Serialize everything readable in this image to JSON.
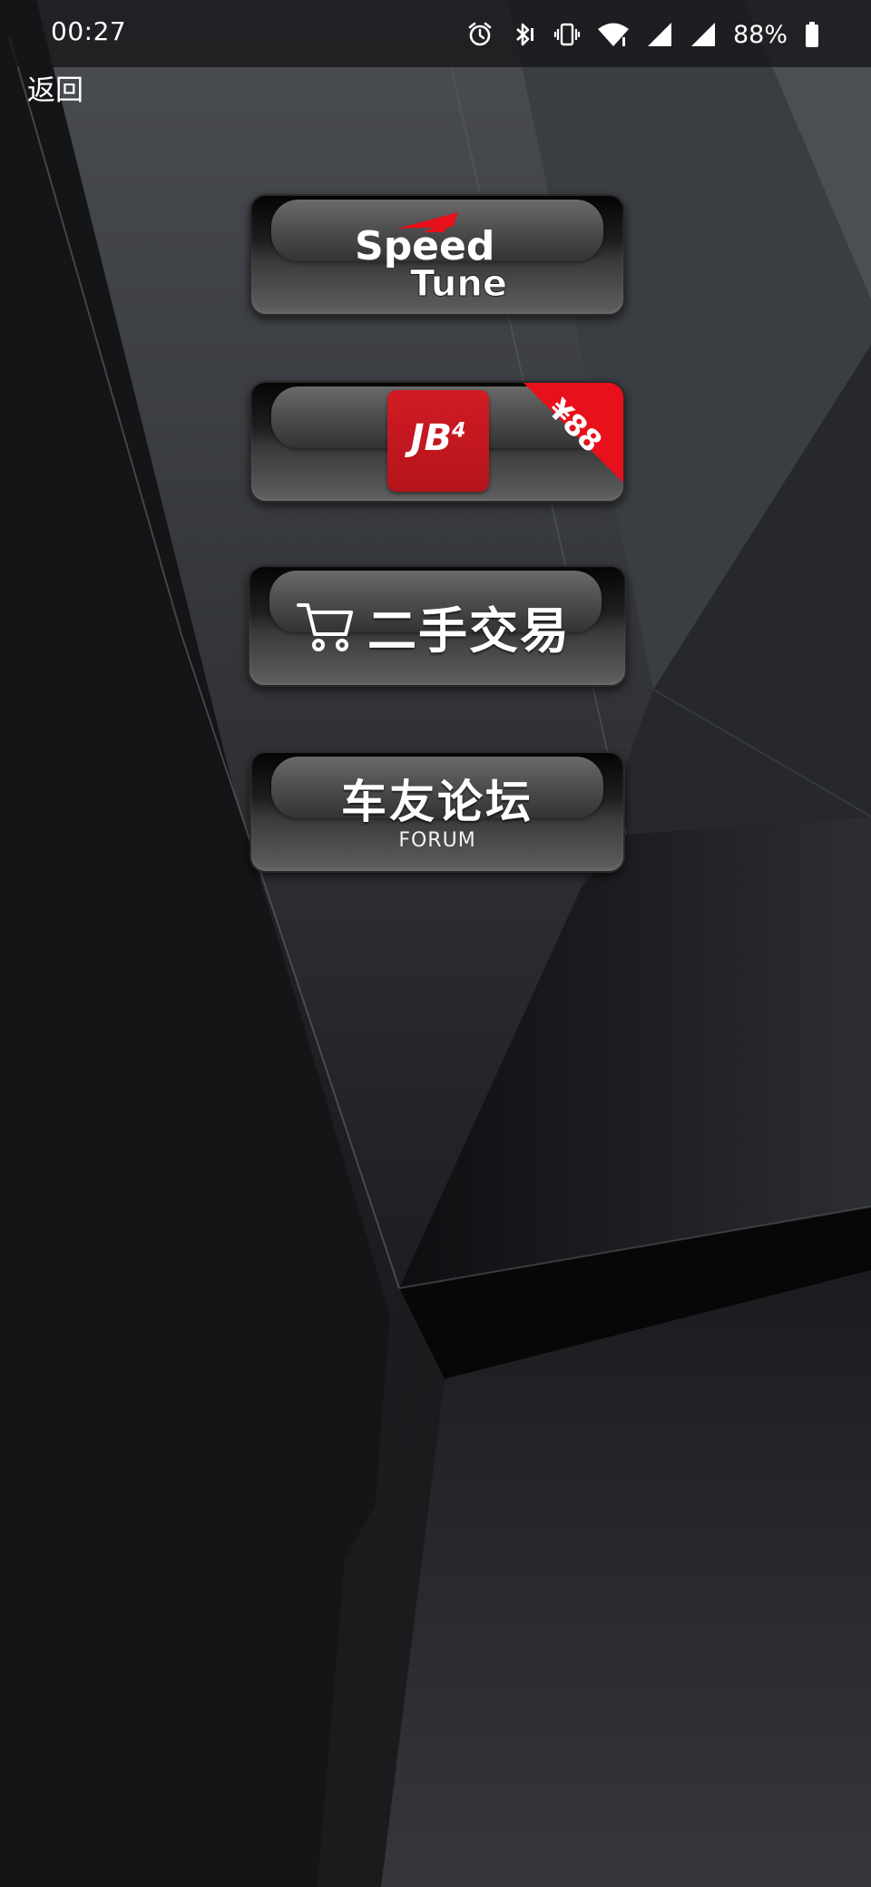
{
  "status_bar": {
    "time": "00:27",
    "battery_percent": "88%",
    "icons": [
      "alarm-icon",
      "bluetooth-icon",
      "vibrate-icon",
      "wifi-icon",
      "signal-icon",
      "signal-icon-2",
      "battery-icon"
    ]
  },
  "nav": {
    "back_label": "返回"
  },
  "menu": {
    "speedtune": {
      "logo_line1": "Speed",
      "logo_line2": "Tune"
    },
    "jb4": {
      "logo": "JB",
      "logo_sup": "4",
      "price": "¥88"
    },
    "used_trade": {
      "label": "二手交易",
      "icon": "shopping-cart-icon"
    },
    "forum": {
      "label_cn": "车友论坛",
      "label_en": "FORUM"
    }
  },
  "colors": {
    "accent_red": "#e8101a",
    "jb4_red": "#c8161f",
    "text": "#ffffff"
  }
}
